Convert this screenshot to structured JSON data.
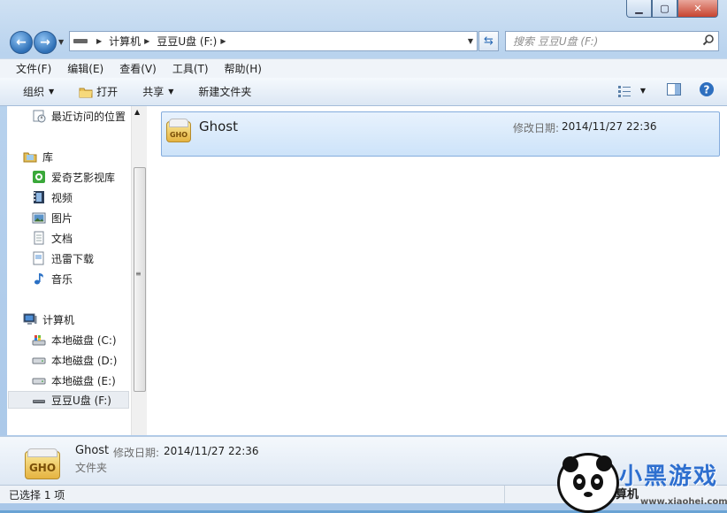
{
  "address": {
    "crumbs": [
      "计算机",
      "豆豆U盘 (F:)"
    ]
  },
  "search": {
    "placeholder": "搜索 豆豆U盘 (F:)"
  },
  "menu": [
    "文件(F)",
    "编辑(E)",
    "查看(V)",
    "工具(T)",
    "帮助(H)"
  ],
  "toolbar": {
    "organize": "组织",
    "open": "打开",
    "share": "共享",
    "new_folder": "新建文件夹"
  },
  "sidebar": {
    "recent": "最近访问的位置",
    "library": "库",
    "library_items": [
      "爱奇艺影视库",
      "视频",
      "图片",
      "文档",
      "迅雷下载",
      "音乐"
    ],
    "computer": "计算机",
    "drives": [
      "本地磁盘 (C:)",
      "本地磁盘 (D:)",
      "本地磁盘 (E:)",
      "豆豆U盘 (F:)"
    ]
  },
  "files": [
    {
      "name": "Ghost",
      "date_label": "修改日期:",
      "date": "2014/11/27 22:36",
      "icon": "gho-icon",
      "icon_text": "GHO"
    }
  ],
  "details": {
    "name": "Ghost",
    "date_label": "修改日期:",
    "date": "2014/11/27 22:36",
    "type": "文件夹",
    "icon_text": "GHO"
  },
  "status": {
    "selected": "已选择 1 项"
  },
  "watermark": {
    "text": "小黑游戏",
    "url": "www.xiaohei.com",
    "partial_text": "算机"
  }
}
